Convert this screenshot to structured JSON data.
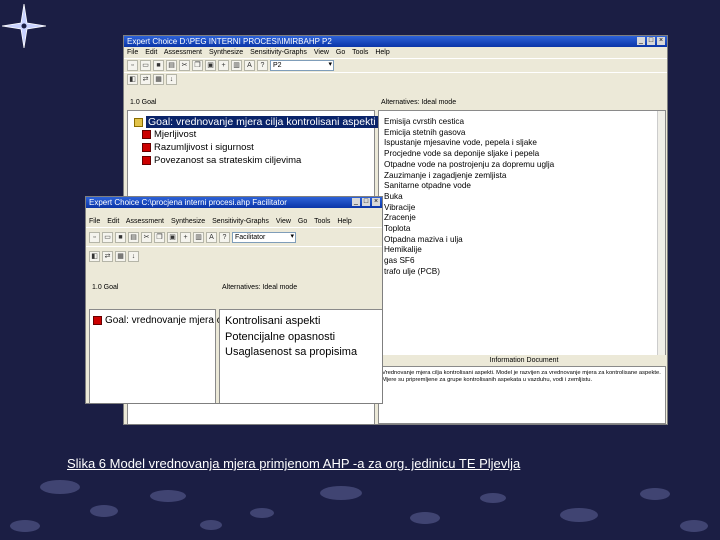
{
  "caption": "Slika 6 Model vrednovanja mjera primjenom AHP -a za org. jedinicu TE Pljevlja",
  "window_back": {
    "title": "Expert Choice    D:\\PEG INTERNI PROCESI\\IMIRBAHP    P2",
    "combo_value": "P2",
    "goal_header": "1.0 Goal",
    "alternatives_header": "Alternatives: Ideal mode",
    "info_header": "Information Document",
    "tree": {
      "goal": "Goal: vrednovanje mjera cilja kontrolisani aspekti",
      "children": [
        "Mjerljivost",
        "Razumljivost i sigurnost",
        "Povezanost sa strateskim ciljevima"
      ]
    },
    "alternatives": [
      "Emisija cvrstih cestica",
      "Emicija stetnih gasova",
      "Ispustanje mjesavine vode, pepela i sljake",
      "Procjedne vode sa deponije sljake i pepela",
      "Otpadne vode na postrojenju za dopremu uglja",
      "Zauzimanje i zagadjenje zemljista",
      "Sanitarne otpadne vode",
      "Buka",
      "Vibracije",
      "Zracenje",
      "Toplota",
      "Otpadna maziva i ulja",
      "Hemikalije",
      "gas SF6",
      "trafo ulje (PCB)"
    ],
    "info_text": "Vrednovanje mjera cilja kontrolisani aspekti. Model je razvijen za vrednovanje mjera za kontrolisane aspekte. Mjere su pripremljene za grupe kontrolisanih aspekata u vazduhu, vodi i zemljistu."
  },
  "window_front": {
    "title": "Expert Choice    C:\\procjena interni procesi.ahp    Facilitator",
    "menu": [
      "File",
      "Edit",
      "Assessment",
      "Synthesize",
      "Sensitivity-Graphs",
      "View",
      "Go",
      "Tools",
      "Help"
    ],
    "combo_value": "Facilitator",
    "goal_header": "1.0 Goal",
    "alternatives_header": "Alternatives: Ideal mode",
    "tree_goal": "Goal: vrednovanje mjera cilja kontrolisani aspekti",
    "alternatives": [
      "Kontrolisani aspekti",
      "Potencijalne opasnosti",
      "Usaglasenost sa propisima"
    ]
  },
  "colors": {
    "background": "#1b1e44",
    "titlebar": "#0a35a8",
    "selection": "#0a246a",
    "node": "#cc0000"
  }
}
